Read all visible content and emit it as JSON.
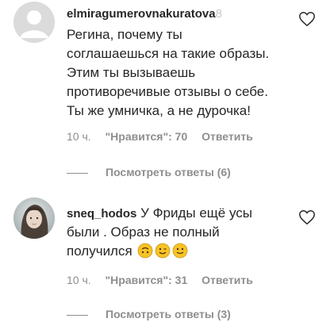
{
  "comments": [
    {
      "username": "elmiragumerovnakuratova",
      "username_faded": "8",
      "text_lines": [
        "Регина, почему ты",
        "соглашаешься на такие образы.",
        "Этим ты вызываешь",
        "противоречивые отзывы о себе.",
        "Ты же умничка, а не дурочка!"
      ],
      "time": "10 ч.",
      "likes": "\"Нравится\": 70",
      "reply_label": "Ответить",
      "view_replies": "Посмотреть ответы (6)"
    },
    {
      "username": "sneq_hodos",
      "text_inline": "У Фриды ещё усы",
      "text_lines": [
        "были . Образ не полный",
        "получился"
      ],
      "emojis": [
        "upside-down-face-icon",
        "winking-face-icon",
        "slightly-smiling-face-icon"
      ],
      "time": "10 ч.",
      "likes": "\"Нравится\": 31",
      "reply_label": "Ответить",
      "view_replies": "Посмотреть ответы (3)"
    }
  ],
  "colors": {
    "text": "#262626",
    "secondary": "#8e8e8e",
    "emoji_yellow": "#f7c325"
  }
}
